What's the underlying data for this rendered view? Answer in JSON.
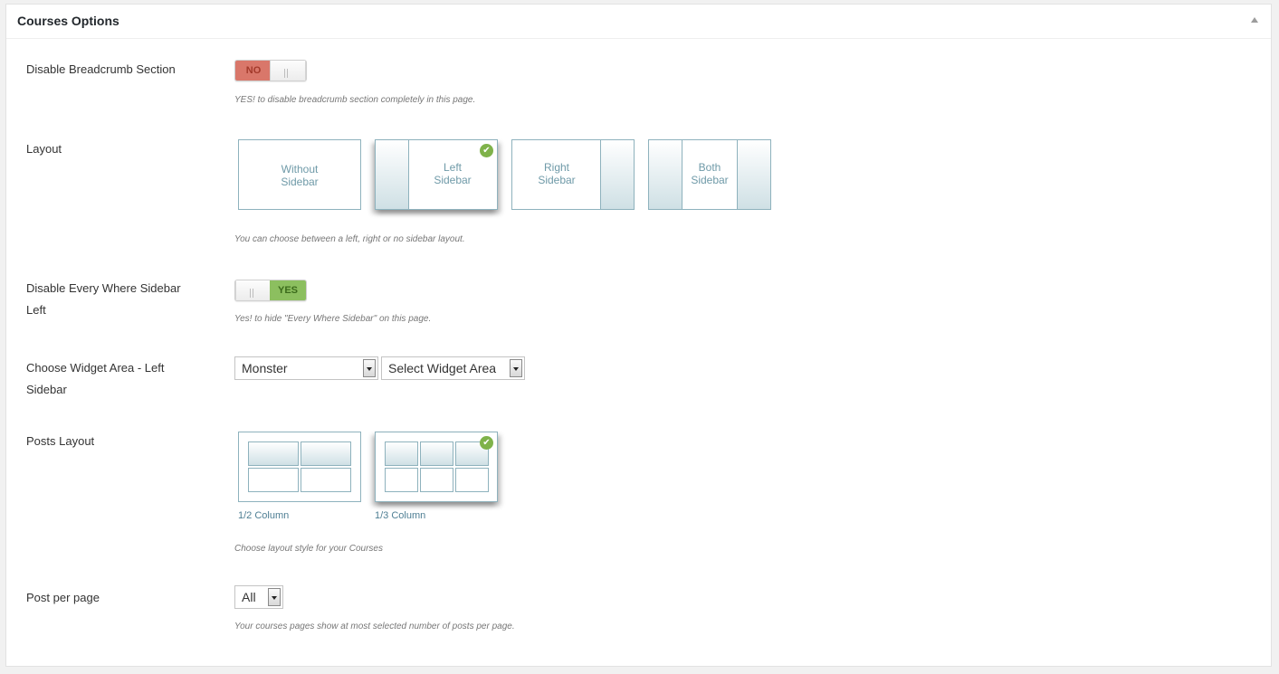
{
  "panel": {
    "title": "Courses Options"
  },
  "breadcrumb": {
    "label": "Disable Breadcrumb Section",
    "state": "NO",
    "desc": "YES! to disable breadcrumb section completely in this page."
  },
  "layout": {
    "label": "Layout",
    "options": [
      {
        "line1": "Without",
        "line2": "Sidebar",
        "selected": false
      },
      {
        "line1": "Left",
        "line2": "Sidebar",
        "selected": true
      },
      {
        "line1": "Right",
        "line2": "Sidebar",
        "selected": false
      },
      {
        "line1": "Both",
        "line2": "Sidebar",
        "selected": false
      }
    ],
    "desc": "You can choose between a left, right or no sidebar layout."
  },
  "everywhere_sidebar": {
    "label_line1": "Disable Every Where Sidebar",
    "label_line2": "Left",
    "state": "YES",
    "desc": "Yes! to hide \"Every Where Sidebar\" on this page."
  },
  "widget_area": {
    "label_line1": "Choose Widget Area - Left",
    "label_line2": "Sidebar",
    "select1": "Monster",
    "select2": "Select Widget Area"
  },
  "posts_layout": {
    "label": "Posts Layout",
    "options": [
      {
        "caption": "1/2 Column",
        "selected": false
      },
      {
        "caption": "1/3 Column",
        "selected": true
      }
    ],
    "desc": "Choose layout style for your Courses"
  },
  "per_page": {
    "label": "Post per page",
    "value": "All",
    "desc": "Your courses pages show at most selected number of posts per page."
  },
  "icons": {
    "collapse": "triangle-up-icon",
    "check": "checkmark-icon",
    "dropdown": "dropdown-arrow-icon"
  },
  "colors": {
    "no": "#d9776a",
    "yes": "#8cbf5f",
    "check": "#7fb24a",
    "box_border": "#8eb2bd"
  }
}
